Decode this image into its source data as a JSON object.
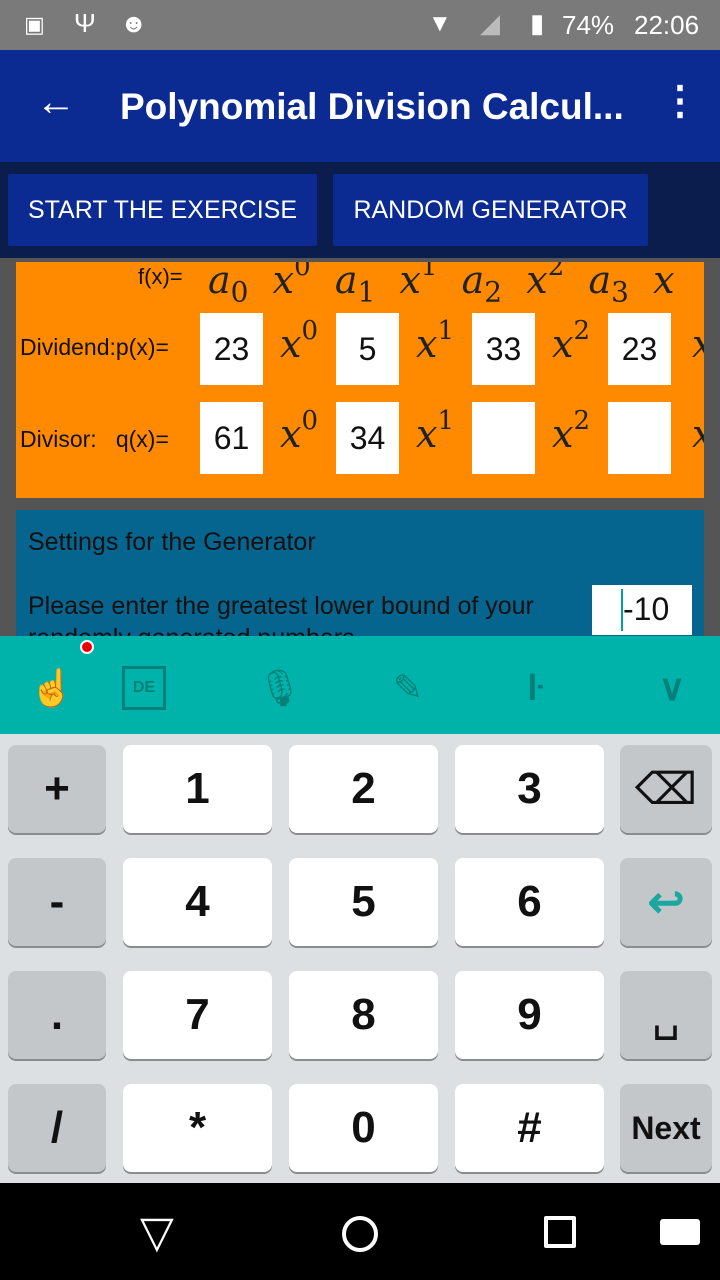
{
  "status": {
    "battery": "74%",
    "time": "22:06",
    "icons": [
      "image-icon",
      "usb-icon",
      "android-icon",
      "wifi-icon",
      "signal-icon",
      "battery-charging-icon"
    ]
  },
  "appbar": {
    "title": "Polynomial Division Calcul...",
    "back_icon": "arrow-left-icon",
    "menu_icon": "more-vert-icon"
  },
  "buttons": {
    "start": "START THE EXERCISE",
    "random": "RANDOM GENERATOR"
  },
  "formula": {
    "label": "f(x)=",
    "terms": [
      "a",
      "x",
      "a",
      "x",
      "a",
      "x",
      "a",
      "x"
    ],
    "subs": [
      "0",
      "1",
      "2",
      "3"
    ],
    "powers": [
      "0",
      "1",
      "2"
    ]
  },
  "dividend": {
    "label": "Dividend:p(x)=",
    "coefficients": [
      "23",
      "5",
      "33",
      "23"
    ]
  },
  "divisor": {
    "label": "Divisor:   q(x)=",
    "coefficients": [
      "61",
      "34",
      "",
      ""
    ]
  },
  "settings": {
    "title": "Settings for the Generator",
    "prompt": "Please enter the greatest lower bound of your randomly generated numbers",
    "lower_bound": "-10"
  },
  "keyboard": {
    "toolbar_icons": [
      "gesture-icon",
      "layout-de-icon",
      "microphone-icon",
      "edit-icon",
      "handwriting-icon",
      "chevron-down-icon"
    ],
    "rows": [
      [
        "+",
        "1",
        "2",
        "3",
        "⌫"
      ],
      [
        "-",
        "4",
        "5",
        "6",
        "↩"
      ],
      [
        ".",
        "7",
        "8",
        "9",
        "␣"
      ],
      [
        "/",
        "*",
        "0",
        "#",
        "Next"
      ]
    ]
  },
  "colors": {
    "appbar": "#0b2b92",
    "orange": "#ff8a00",
    "settings": "#06658f",
    "keyboard_bar": "#00b3aa"
  }
}
